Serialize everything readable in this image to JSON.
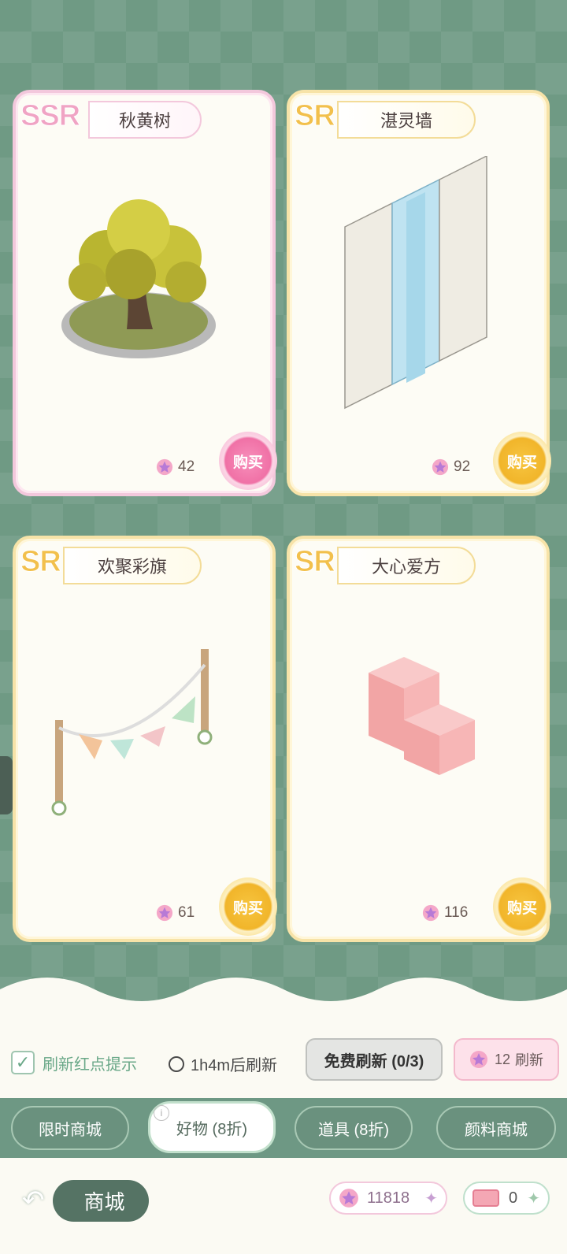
{
  "cards": [
    {
      "rarity": "SSR",
      "name": "秋黄树",
      "price": "42",
      "buy": "购买"
    },
    {
      "rarity": "SR",
      "name": "湛灵墙",
      "price": "92",
      "buy": "购买"
    },
    {
      "rarity": "SR",
      "name": "欢聚彩旗",
      "price": "61",
      "buy": "购买"
    },
    {
      "rarity": "SR",
      "name": "大心爱方",
      "price": "116",
      "buy": "购买"
    }
  ],
  "refresh": {
    "reddot_label": "刷新红点提示",
    "reddot_checked": true,
    "timer": "1h4m后刷新",
    "free_label": "免费刷新 (0/3)",
    "paid_cost": "12",
    "paid_label": "刷新"
  },
  "tabs": [
    {
      "label": "限时商城",
      "active": false
    },
    {
      "label": "好物 (8折)",
      "active": true
    },
    {
      "label": "道具 (8折)",
      "active": false
    },
    {
      "label": "颜料商城",
      "active": false
    }
  ],
  "footer": {
    "title": "商城",
    "currency1": "11818",
    "currency2": "0"
  },
  "colors": {
    "background": "#6f9a84",
    "ssr_accent": "#f071a6",
    "sr_accent": "#f1b52a",
    "tab_bar": "#6e9884"
  }
}
